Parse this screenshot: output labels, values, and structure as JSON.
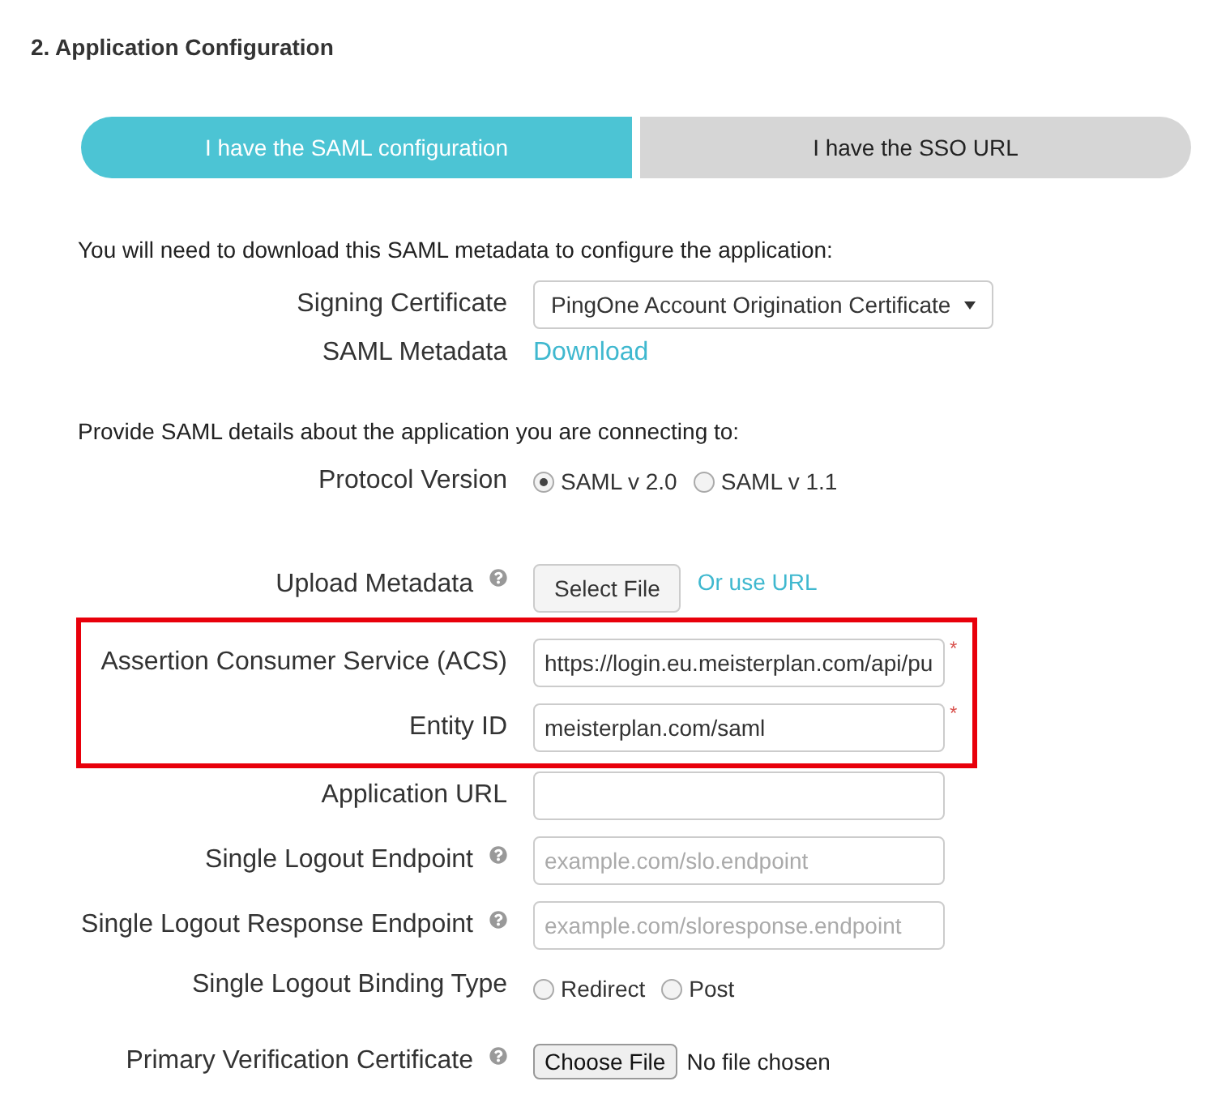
{
  "heading": "2. Application Configuration",
  "tabs": [
    {
      "label": "I have the SAML configuration",
      "selected": true
    },
    {
      "label": "I have the SSO URL",
      "selected": false
    }
  ],
  "sections": [
    {
      "intro": "You will need to download this SAML metadata to configure the application:",
      "rows": [
        {
          "kind": "select",
          "label": "Signing Certificate",
          "value": "PingOne Account Origination Certificate"
        },
        {
          "kind": "link",
          "label": "SAML Metadata",
          "link": "Download"
        }
      ]
    },
    {
      "intro": "Provide SAML details about the application you are connecting to:",
      "rows": [
        {
          "kind": "radio",
          "label": "Protocol Version",
          "options": [
            {
              "label": "SAML v 2.0",
              "selected": true
            },
            {
              "label": "SAML v 1.1",
              "selected": false
            }
          ]
        },
        {
          "kind": "upload",
          "label": "Upload Metadata",
          "help": true,
          "button": "Select File",
          "link": "Or use URL"
        },
        {
          "kind": "text",
          "label": "Assertion Consumer Service (ACS)",
          "value": "https://login.eu.meisterplan.com/api/pu",
          "required_mark": "*",
          "highlighted": true
        },
        {
          "kind": "text",
          "label": "Entity ID",
          "value": "meisterplan.com/saml",
          "required_mark": "*",
          "highlighted": true
        },
        {
          "kind": "text",
          "label": "Application URL"
        },
        {
          "kind": "text",
          "label": "Single Logout Endpoint",
          "help": true,
          "placeholder": "example.com/slo.endpoint"
        },
        {
          "kind": "text",
          "label": "Single Logout Response Endpoint",
          "help": true,
          "placeholder": "example.com/sloresponse.endpoint"
        },
        {
          "kind": "radio",
          "label": "Single Logout Binding Type",
          "options": [
            {
              "label": "Redirect",
              "selected": false
            },
            {
              "label": "Post",
              "selected": false
            }
          ]
        },
        {
          "kind": "file",
          "label": "Primary Verification Certificate",
          "help": true,
          "button": "Choose File",
          "status": "No file chosen"
        }
      ]
    }
  ]
}
